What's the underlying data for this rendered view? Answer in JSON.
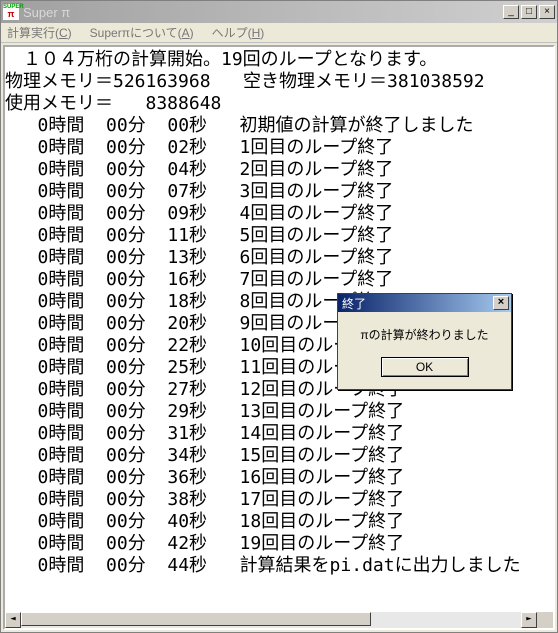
{
  "window": {
    "title": "Super π"
  },
  "menubar": {
    "calc": "計算実行(C)",
    "about": "Superπについて(A)",
    "help": "ヘルプ(H)"
  },
  "header": {
    "line1": "　１０４万桁の計算開始。19回のループとなります。",
    "line2a": "物理メモリ＝526163968",
    "line2b": "空き物理メモリ＝381038592",
    "line3": "使用メモリ＝   8388648"
  },
  "log": [
    {
      "h": "0時間",
      "m": "00分",
      "s": "00秒",
      "msg": "初期値の計算が終了しました"
    },
    {
      "h": "0時間",
      "m": "00分",
      "s": "02秒",
      "msg": "1回目のループ終了"
    },
    {
      "h": "0時間",
      "m": "00分",
      "s": "04秒",
      "msg": "2回目のループ終了"
    },
    {
      "h": "0時間",
      "m": "00分",
      "s": "07秒",
      "msg": "3回目のループ終了"
    },
    {
      "h": "0時間",
      "m": "00分",
      "s": "09秒",
      "msg": "4回目のループ終了"
    },
    {
      "h": "0時間",
      "m": "00分",
      "s": "11秒",
      "msg": "5回目のループ終了"
    },
    {
      "h": "0時間",
      "m": "00分",
      "s": "13秒",
      "msg": "6回目のループ終了"
    },
    {
      "h": "0時間",
      "m": "00分",
      "s": "16秒",
      "msg": "7回目のループ終了"
    },
    {
      "h": "0時間",
      "m": "00分",
      "s": "18秒",
      "msg": "8回目のループ終了"
    },
    {
      "h": "0時間",
      "m": "00分",
      "s": "20秒",
      "msg": "9回目のループ終了"
    },
    {
      "h": "0時間",
      "m": "00分",
      "s": "22秒",
      "msg": "10回目のループ終了"
    },
    {
      "h": "0時間",
      "m": "00分",
      "s": "25秒",
      "msg": "11回目のループ終了"
    },
    {
      "h": "0時間",
      "m": "00分",
      "s": "27秒",
      "msg": "12回目のループ終了"
    },
    {
      "h": "0時間",
      "m": "00分",
      "s": "29秒",
      "msg": "13回目のループ終了"
    },
    {
      "h": "0時間",
      "m": "00分",
      "s": "31秒",
      "msg": "14回目のループ終了"
    },
    {
      "h": "0時間",
      "m": "00分",
      "s": "34秒",
      "msg": "15回目のループ終了"
    },
    {
      "h": "0時間",
      "m": "00分",
      "s": "36秒",
      "msg": "16回目のループ終了"
    },
    {
      "h": "0時間",
      "m": "00分",
      "s": "38秒",
      "msg": "17回目のループ終了"
    },
    {
      "h": "0時間",
      "m": "00分",
      "s": "40秒",
      "msg": "18回目のループ終了"
    },
    {
      "h": "0時間",
      "m": "00分",
      "s": "42秒",
      "msg": "19回目のループ終了"
    },
    {
      "h": "0時間",
      "m": "00分",
      "s": "44秒",
      "msg": "計算結果をpi.datに出力しました"
    }
  ],
  "dialog": {
    "title": "終了",
    "message": "πの計算が終わりました",
    "ok": "OK"
  },
  "title_buttons": {
    "min": "_",
    "max": "□",
    "close": "×"
  },
  "scroll": {
    "left": "◄",
    "right": "►"
  }
}
